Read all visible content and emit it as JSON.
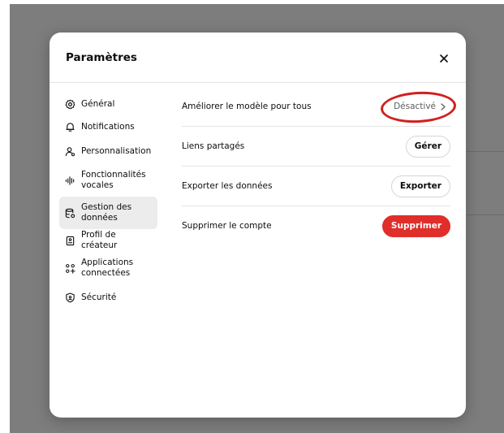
{
  "modal": {
    "title": "Paramètres",
    "close_label": "×"
  },
  "sidebar": {
    "items": [
      {
        "label": "Général",
        "icon": "gear-icon",
        "active": false
      },
      {
        "label": "Notifications",
        "icon": "bell-icon",
        "active": false
      },
      {
        "label": "Personnalisation",
        "icon": "person-icon",
        "active": false
      },
      {
        "label": "Fonctionnalités vocales",
        "icon": "waveform-icon",
        "active": false
      },
      {
        "label": "Gestion des données",
        "icon": "database-icon",
        "active": true
      },
      {
        "label": "Profil de créateur",
        "icon": "badge-icon",
        "active": false
      },
      {
        "label": "Applications connectées",
        "icon": "apps-grid-icon",
        "active": false
      },
      {
        "label": "Sécurité",
        "icon": "shield-icon",
        "active": false
      }
    ]
  },
  "main": {
    "rows": [
      {
        "label": "Améliorer le modèle pour tous",
        "action": "Désactivé",
        "action_icon": "chevron-right-icon"
      },
      {
        "label": "Liens partagés",
        "action": "Gérer"
      },
      {
        "label": "Exporter les données",
        "action": "Exporter"
      },
      {
        "label": "Supprimer le compte",
        "action": "Supprimer"
      }
    ]
  },
  "colors": {
    "danger": "#e02e2a",
    "highlight_ring": "#d21f1f",
    "active_nav": "#ececec",
    "backdrop": "#7d7d7d"
  }
}
